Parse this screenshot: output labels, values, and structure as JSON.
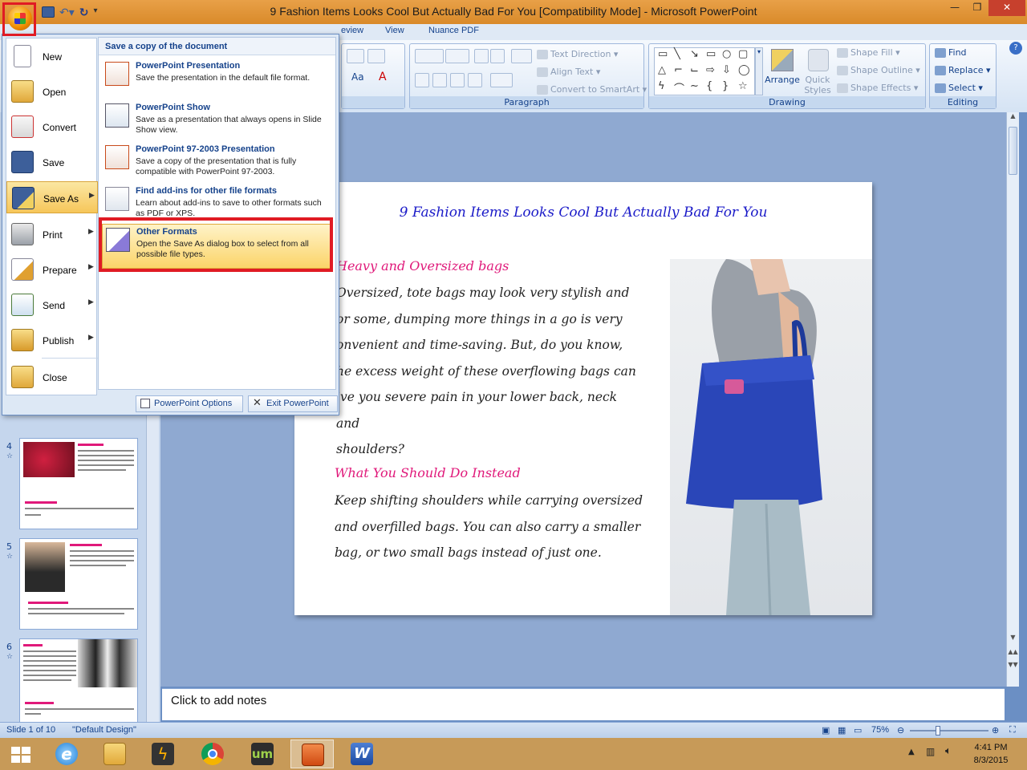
{
  "window": {
    "title": "9 Fashion Items Looks Cool But Actually Bad For You [Compatibility Mode] - Microsoft PowerPoint"
  },
  "ribbon": {
    "tabs": [
      "eview",
      "View",
      "Nuance PDF"
    ],
    "paragraph": {
      "label": "Paragraph",
      "text_direction": "Text Direction",
      "align_text": "Align Text",
      "convert_smartart": "Convert to SmartArt"
    },
    "drawing": {
      "label": "Drawing",
      "arrange": "Arrange",
      "quick_styles_1": "Quick",
      "quick_styles_2": "Styles",
      "shape_fill": "Shape Fill",
      "shape_outline": "Shape Outline",
      "shape_effects": "Shape Effects"
    },
    "editing": {
      "label": "Editing",
      "find": "Find",
      "replace": "Replace",
      "select": "Select"
    },
    "font_aa": "Aa",
    "font_a": "A"
  },
  "office_menu": {
    "left_items": [
      {
        "label": "New",
        "icon": "new-document-icon"
      },
      {
        "label": "Open",
        "icon": "open-folder-icon"
      },
      {
        "label": "Convert",
        "icon": "convert-icon"
      },
      {
        "label": "Save",
        "icon": "save-icon"
      },
      {
        "label": "Save As",
        "icon": "save-as-icon"
      },
      {
        "label": "Print",
        "icon": "print-icon"
      },
      {
        "label": "Prepare",
        "icon": "prepare-icon"
      },
      {
        "label": "Send",
        "icon": "send-icon"
      },
      {
        "label": "Publish",
        "icon": "publish-icon"
      },
      {
        "label": "Close",
        "icon": "close-folder-icon"
      }
    ],
    "right_header": "Save a copy of the document",
    "options": [
      {
        "title": "PowerPoint Presentation",
        "desc": "Save the presentation in the default file format."
      },
      {
        "title": "PowerPoint Show",
        "desc": "Save as a presentation that always opens in Slide Show view."
      },
      {
        "title": "PowerPoint 97-2003 Presentation",
        "desc": "Save a copy of the presentation that is fully compatible with PowerPoint 97-2003."
      },
      {
        "title": "Find add-ins for other file formats",
        "desc": "Learn about add-ins to save to other formats such as PDF or XPS."
      },
      {
        "title": "Other Formats",
        "desc": "Open the Save As dialog box to select from all possible file types."
      }
    ],
    "options_button": "PowerPoint Options",
    "exit_button": "Exit PowerPoint"
  },
  "slide": {
    "title": "9 Fashion Items Looks Cool But Actually Bad For You",
    "heading1": "Heavy and Oversized bags",
    "body1": [
      "Oversized, tote bags may look very stylish and",
      "or some, dumping more things in a go is very",
      "onvenient and time-saving. But, do you know,",
      "he excess weight of these overflowing bags can",
      "ive you severe pain in your lower back, neck and",
      "shoulders?"
    ],
    "heading2": "What You Should Do Instead",
    "body2": [
      "Keep shifting shoulders while carrying oversized",
      "and overfilled bags. You can also carry a smaller",
      "bag, or two small bags instead of just one."
    ]
  },
  "thumbnails": [
    {
      "num": "4"
    },
    {
      "num": "5"
    },
    {
      "num": "6"
    }
  ],
  "notes_placeholder": "Click to add notes",
  "status": {
    "slide": "Slide 1 of 10",
    "design": "\"Default Design\"",
    "zoom": "75%"
  },
  "clock": {
    "time": "4:41 PM",
    "date": "8/3/2015"
  },
  "colors": {
    "accent_red": "#e01b24",
    "title_blue": "#1a1ac8",
    "heading_pink": "#e0197a"
  }
}
